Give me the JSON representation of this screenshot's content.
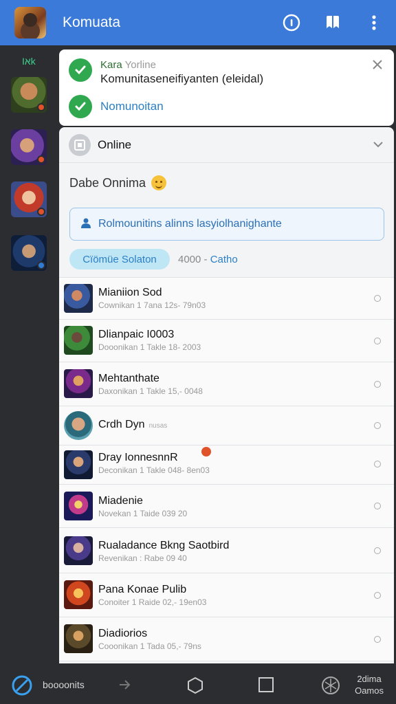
{
  "topbar": {
    "title": "Komuata"
  },
  "rail": {
    "label": "Iאk",
    "avatars": [
      "character-avatar",
      "character-avatar",
      "character-avatar",
      "character-avatar"
    ]
  },
  "notification": {
    "app_name": "Kara",
    "status": "Yorline",
    "body": "Komunitaseneifiyanten (eleidal)",
    "action": "Nomunoitan"
  },
  "panel": {
    "header_title": "Online",
    "greeting": "Dabe Onnima",
    "search_text": "Rolmounitins alinns lasyiolhanighante",
    "chip_label": "Cïömüe Solaton",
    "chip_meta_prefix": "4000 -",
    "chip_meta_accent": "Catho"
  },
  "list": [
    {
      "title": "Mianiion Sod",
      "subtitle": "Cownikan 1 7ana 12s- 79n03",
      "note": ""
    },
    {
      "title": "Dlianpaic I0003",
      "subtitle": "Dooonikan 1 Takle 18- 2003",
      "note": ""
    },
    {
      "title": "Mehtanthate",
      "subtitle": "Daxonikan 1 Takle 15,- 0048",
      "note": ""
    },
    {
      "title": "Crdh Dyn",
      "subtitle": "",
      "note": "nusas"
    },
    {
      "title": "Dray IonnesnnR",
      "subtitle": "Deconikan 1 Takle 048- 8en03",
      "note": ""
    },
    {
      "title": "Miadenie",
      "subtitle": "Novekan 1 Taide 039 20",
      "note": ""
    },
    {
      "title": "Rualadance Bkng Saotbird",
      "subtitle": "Revenikan : Rabe 09 40",
      "note": ""
    },
    {
      "title": "Pana Konae Pulib",
      "subtitle": "Conoiter 1 Raide 02,- 19en03",
      "note": ""
    },
    {
      "title": "Diadiorios",
      "subtitle": "Cooonikan 1 Tada 05,- 79ns",
      "note": ""
    }
  ],
  "bottombar": {
    "label": "boooonits",
    "right_line1": "2dima",
    "right_line2": "Oamos"
  },
  "colors": {
    "topbar": "#3b7ad9",
    "accent_blue": "#2b7fc7",
    "success_green": "#2fa84f",
    "rail_label_green": "#3ecf8e",
    "badge_red": "#e0522a"
  }
}
